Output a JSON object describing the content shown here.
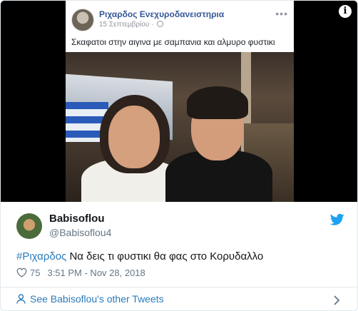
{
  "media": {
    "info_glyph": "i",
    "facebook_post": {
      "author_name": "Ριχαρδος Ενεχυροδανειστηρια",
      "date": "15 Σεπτεμβρίου",
      "date_separator": "·",
      "more_glyph": "•••",
      "caption": "Σκαφατοι στην αιγινα με σαμπανια και αλμυρο φυστικι"
    }
  },
  "tweet": {
    "display_name": "Babisoflou",
    "handle": "@Babisoflou4",
    "hashtag": "#Ριχαρδος",
    "text": " Να δεις τι φυστικι  θα φας στο Κορυδαλλο",
    "likes": "75",
    "timestamp": "3:51 PM - Nov 28, 2018"
  },
  "footer": {
    "other_tweets_label": "See Babisoflou's other Tweets"
  },
  "colors": {
    "link": "#2b7bb9",
    "muted": "#657786",
    "twitter_blue": "#1da1f2",
    "border": "#e1e8ed"
  },
  "icons": [
    "info-icon",
    "globe-icon",
    "more-options-icon",
    "twitter-bird-icon",
    "heart-icon",
    "person-icon",
    "chevron-right-icon"
  ]
}
